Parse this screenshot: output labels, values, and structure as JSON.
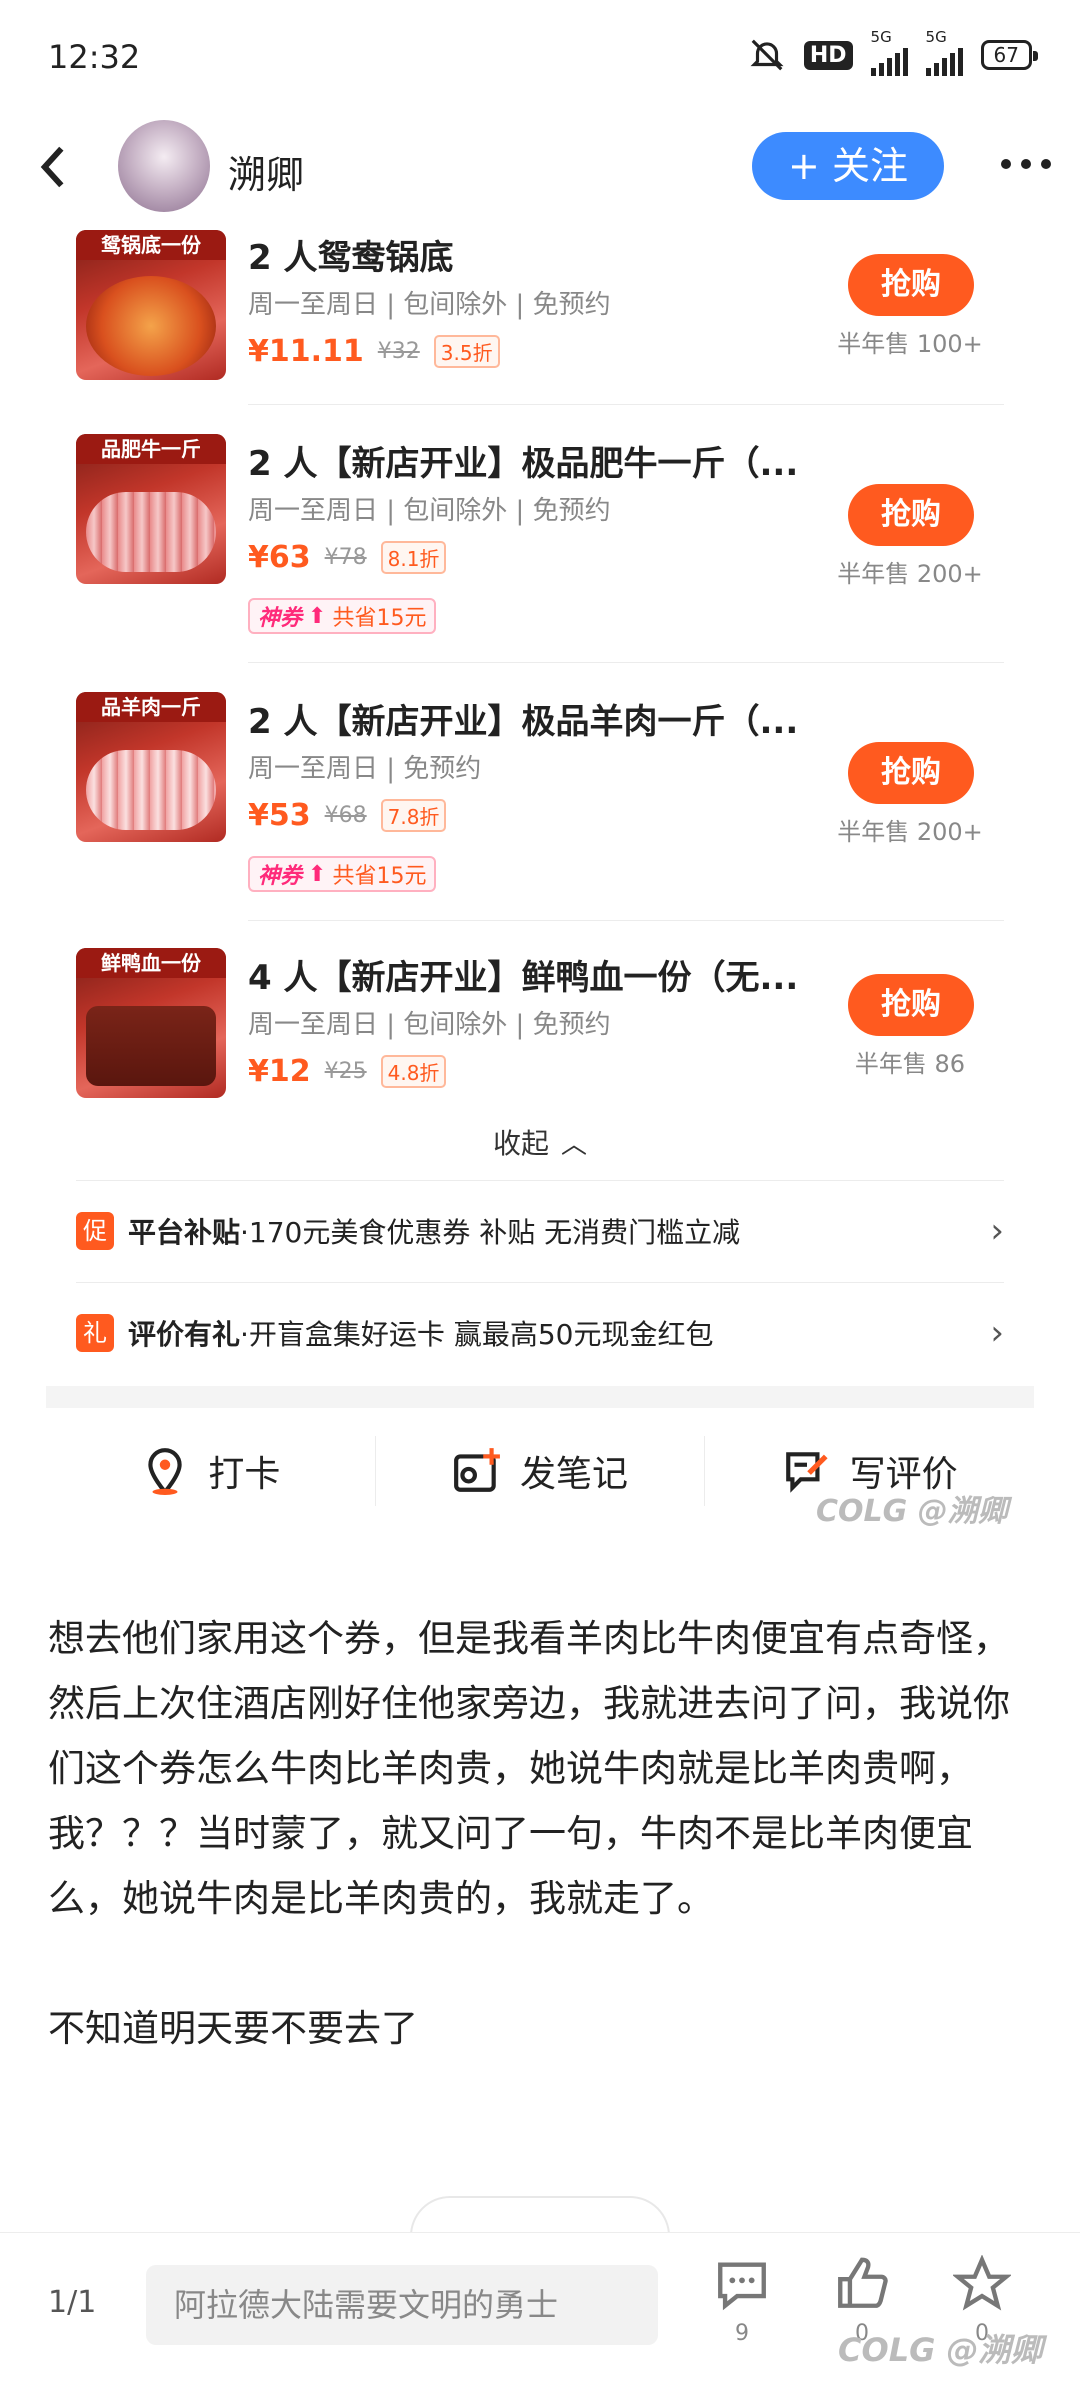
{
  "status_bar": {
    "time": "12:32",
    "network_badge": "HD",
    "signal1_label": "5G",
    "signal2_label": "5G",
    "battery": "67"
  },
  "header": {
    "username": "溯卿",
    "follow_label": "+ 关注"
  },
  "deals": [
    {
      "image_label": "鸳锅底一份",
      "title": "2 人鸳鸯锅底",
      "subtitle": "周一至周日 | 包间除外 | 免预约",
      "price": "¥11.11",
      "original_price": "¥32",
      "discount": "3.5折",
      "coupon": null,
      "buy_label": "抢购",
      "sold": "半年售 100+"
    },
    {
      "image_label": "品肥牛一斤",
      "title": "2 人【新店开业】极品肥牛一斤（...",
      "subtitle": "周一至周日 | 包间除外 | 免预约",
      "price": "¥63",
      "original_price": "¥78",
      "discount": "8.1折",
      "coupon": {
        "brand": "神券",
        "save": "共省15元"
      },
      "buy_label": "抢购",
      "sold": "半年售 200+"
    },
    {
      "image_label": "品羊肉一斤",
      "title": "2 人【新店开业】极品羊肉一斤（...",
      "subtitle": "周一至周日 | 免预约",
      "price": "¥53",
      "original_price": "¥68",
      "discount": "7.8折",
      "coupon": {
        "brand": "神券",
        "save": "共省15元"
      },
      "buy_label": "抢购",
      "sold": "半年售 200+"
    },
    {
      "image_label": "鲜鸭血一份",
      "title": "4 人【新店开业】鲜鸭血一份（无...",
      "subtitle": "周一至周日 | 包间除外 | 免预约",
      "price": "¥12",
      "original_price": "¥25",
      "discount": "4.8折",
      "coupon": null,
      "buy_label": "抢购",
      "sold": "半年售 86"
    }
  ],
  "collapse_label": "收起",
  "promos": [
    {
      "icon": "促",
      "title": "平台补贴",
      "desc": "·170元美食优惠券 补贴 无消费门槛立减"
    },
    {
      "icon": "礼",
      "title": "评价有礼",
      "desc": "·开盲盒集好运卡 赢最高50元现金红包"
    }
  ],
  "actions": [
    {
      "label": "打卡",
      "icon": "location-pin-icon"
    },
    {
      "label": "发笔记",
      "icon": "image-add-icon"
    },
    {
      "label": "写评价",
      "icon": "write-review-icon"
    }
  ],
  "watermark": "COLG @溯卿",
  "post": {
    "paragraph1": "想去他们家用这个券，但是我看羊肉比牛肉便宜有点奇怪，然后上次住酒店刚好住他家旁边，我就进去问了问，我说你们这个券怎么牛肉比羊肉贵，她说牛肉就是比羊肉贵啊，我？？？当时蒙了，就又问了一句，牛肉不是比羊肉便宜么，她说牛肉是比羊肉贵的，我就走了。",
    "paragraph2": "不知道明天要不要去了"
  },
  "bottom_bar": {
    "page_count": "1/1",
    "comment_placeholder": "阿拉德大陆需要文明的勇士",
    "comment_count": "9",
    "like_count": "0",
    "favorite_count": "0"
  },
  "colors": {
    "accent": "#ff5a1f",
    "follow_blue": "#3d8bff",
    "coupon_pink": "#ff2a7a"
  }
}
